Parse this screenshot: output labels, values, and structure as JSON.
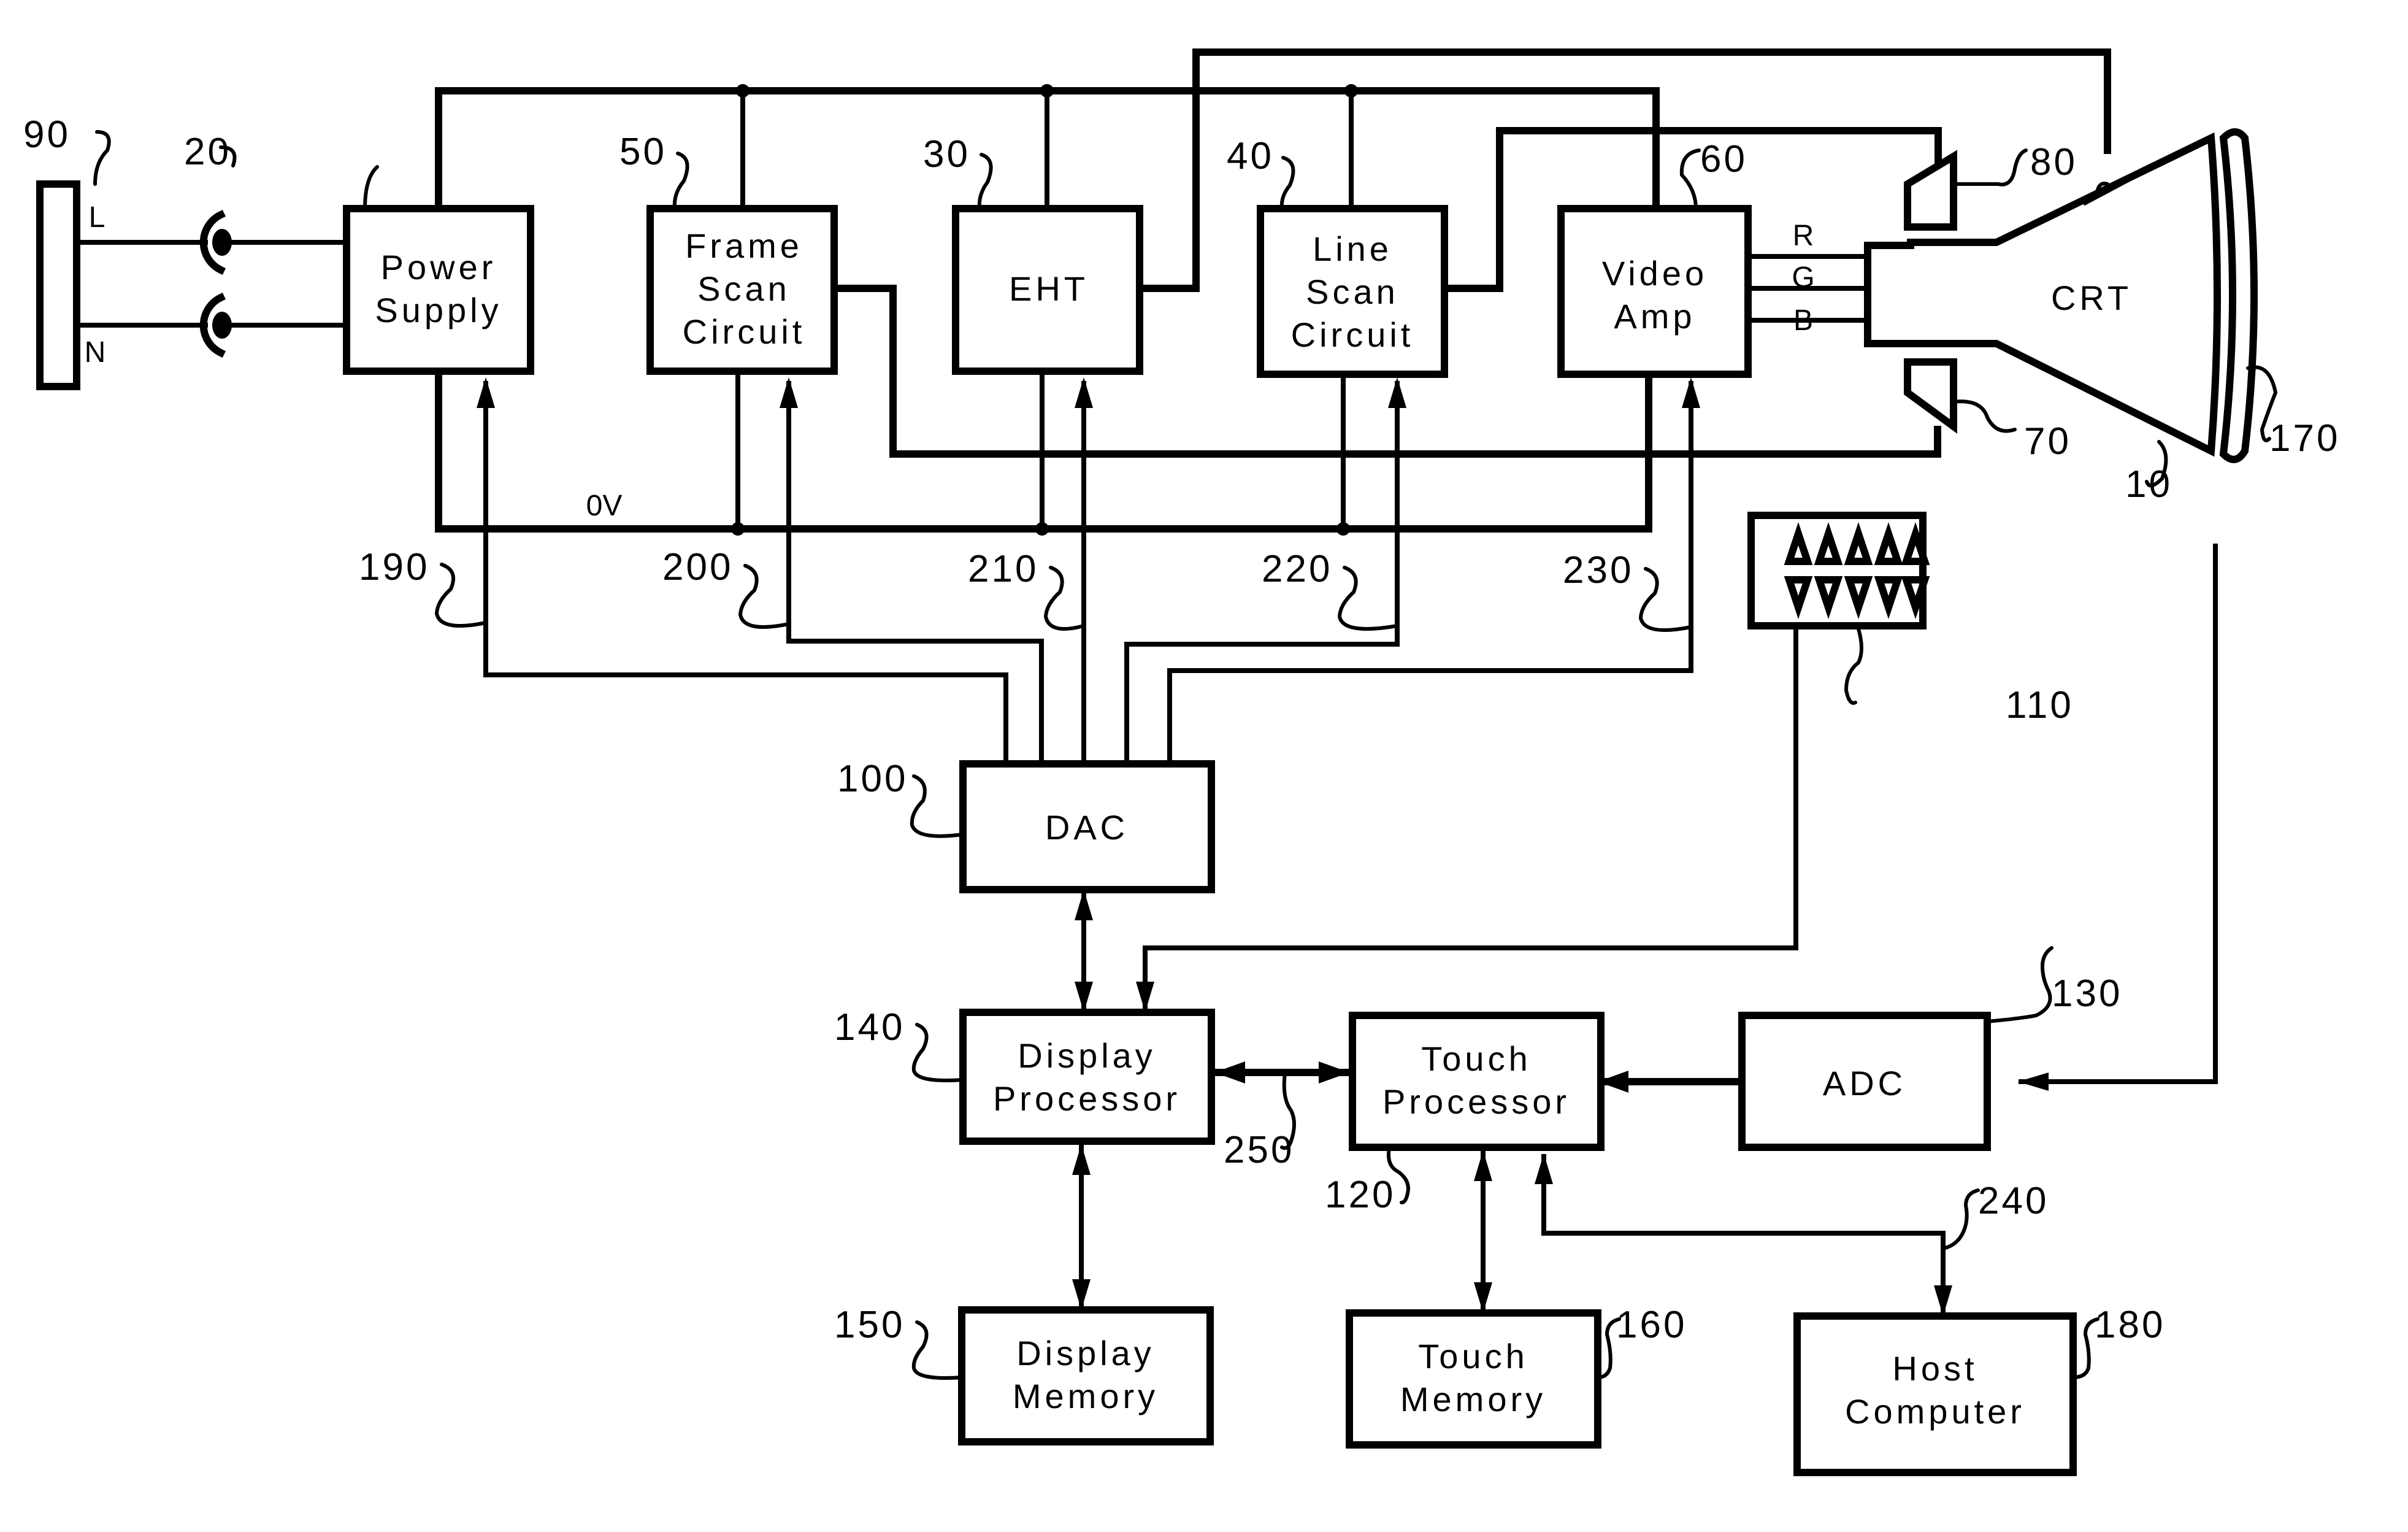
{
  "diagram": {
    "type": "block-diagram",
    "blocks": {
      "mains": {
        "ref": "90"
      },
      "power_supply": {
        "ref": "20",
        "lines": [
          "Power",
          "Supply"
        ]
      },
      "frame_scan": {
        "ref": "50",
        "lines": [
          "Frame",
          "Scan",
          "Circuit"
        ]
      },
      "eht": {
        "ref": "30",
        "lines": [
          "EHT"
        ]
      },
      "line_scan": {
        "ref": "40",
        "lines": [
          "Line",
          "Scan",
          "Circuit"
        ]
      },
      "video_amp": {
        "ref": "60",
        "lines": [
          "Video",
          "Amp"
        ]
      },
      "crt": {
        "ref": "10",
        "lines": [
          "CRT"
        ]
      },
      "deflection_upper": {
        "ref": "80"
      },
      "deflection_lower": {
        "ref": "70"
      },
      "touch_screen": {
        "ref": "170"
      },
      "button_panel": {
        "ref": "110",
        "up_buttons": 5,
        "down_buttons": 5
      },
      "dac": {
        "ref": "100",
        "lines": [
          "DAC"
        ]
      },
      "display_processor": {
        "ref": "140",
        "lines": [
          "Display",
          "Processor"
        ]
      },
      "touch_processor": {
        "ref": "120",
        "lines": [
          "Touch",
          "Processor"
        ]
      },
      "adc": {
        "ref": "130",
        "lines": [
          "ADC"
        ]
      },
      "display_memory": {
        "ref": "150",
        "lines": [
          "Display",
          "Memory"
        ]
      },
      "touch_memory": {
        "ref": "160",
        "lines": [
          "Touch",
          "Memory"
        ]
      },
      "host_computer": {
        "ref": "180",
        "lines": [
          "Host",
          "Computer"
        ]
      }
    },
    "signals": {
      "live": "L",
      "neutral": "N",
      "ground": "0V",
      "red": "R",
      "green": "G",
      "blue": "B"
    },
    "links": {
      "dac_to_power": "190",
      "dac_to_frame": "200",
      "dac_to_eht": "210",
      "dac_to_line": "220",
      "dac_to_video": "230",
      "host_link": "240",
      "processor_bus": "250"
    }
  }
}
